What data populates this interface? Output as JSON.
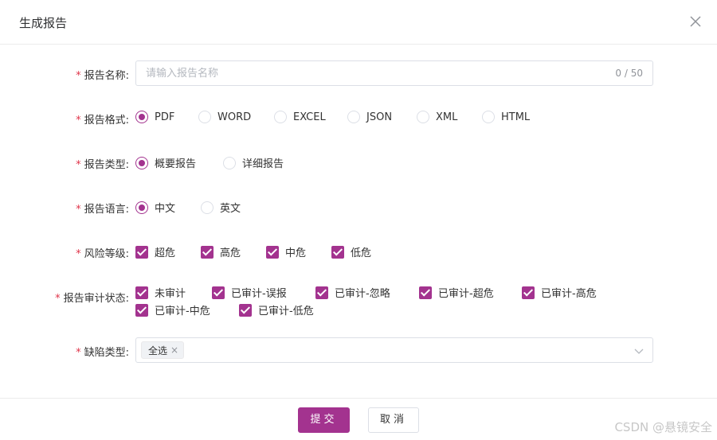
{
  "dialog": {
    "title": "生成报告"
  },
  "form": {
    "report_name": {
      "label": "报告名称:",
      "placeholder": "请输入报告名称",
      "value": "",
      "counter": "0 / 50"
    },
    "report_format": {
      "label": "报告格式:",
      "options": [
        "PDF",
        "WORD",
        "EXCEL",
        "JSON",
        "XML",
        "HTML"
      ],
      "selected": "PDF"
    },
    "report_type": {
      "label": "报告类型:",
      "options": [
        "概要报告",
        "详细报告"
      ],
      "selected": "概要报告"
    },
    "report_language": {
      "label": "报告语言:",
      "options": [
        "中文",
        "英文"
      ],
      "selected": "中文"
    },
    "risk_level": {
      "label": "风险等级:",
      "options": [
        "超危",
        "高危",
        "中危",
        "低危"
      ],
      "checked": [
        "超危",
        "高危",
        "中危",
        "低危"
      ]
    },
    "audit_status": {
      "label": "报告审计状态:",
      "options": [
        "未审计",
        "已审计-误报",
        "已审计-忽略",
        "已审计-超危",
        "已审计-高危",
        "已审计-中危",
        "已审计-低危"
      ],
      "checked": [
        "未审计",
        "已审计-误报",
        "已审计-忽略",
        "已审计-超危",
        "已审计-高危",
        "已审计-中危",
        "已审计-低危"
      ]
    },
    "defect_type": {
      "label": "缺陷类型:",
      "tags": [
        "全选"
      ],
      "tag_close": "×"
    },
    "required_mark": "*"
  },
  "footer": {
    "submit_label": "提交",
    "cancel_label": "取消"
  },
  "watermark": "CSDN @悬镜安全",
  "colors": {
    "accent": "#a3338f",
    "required": "#e0344a",
    "border": "#dcdfe6"
  },
  "icons": {
    "close": "close-icon",
    "dropdown": "chevron-down-icon"
  }
}
